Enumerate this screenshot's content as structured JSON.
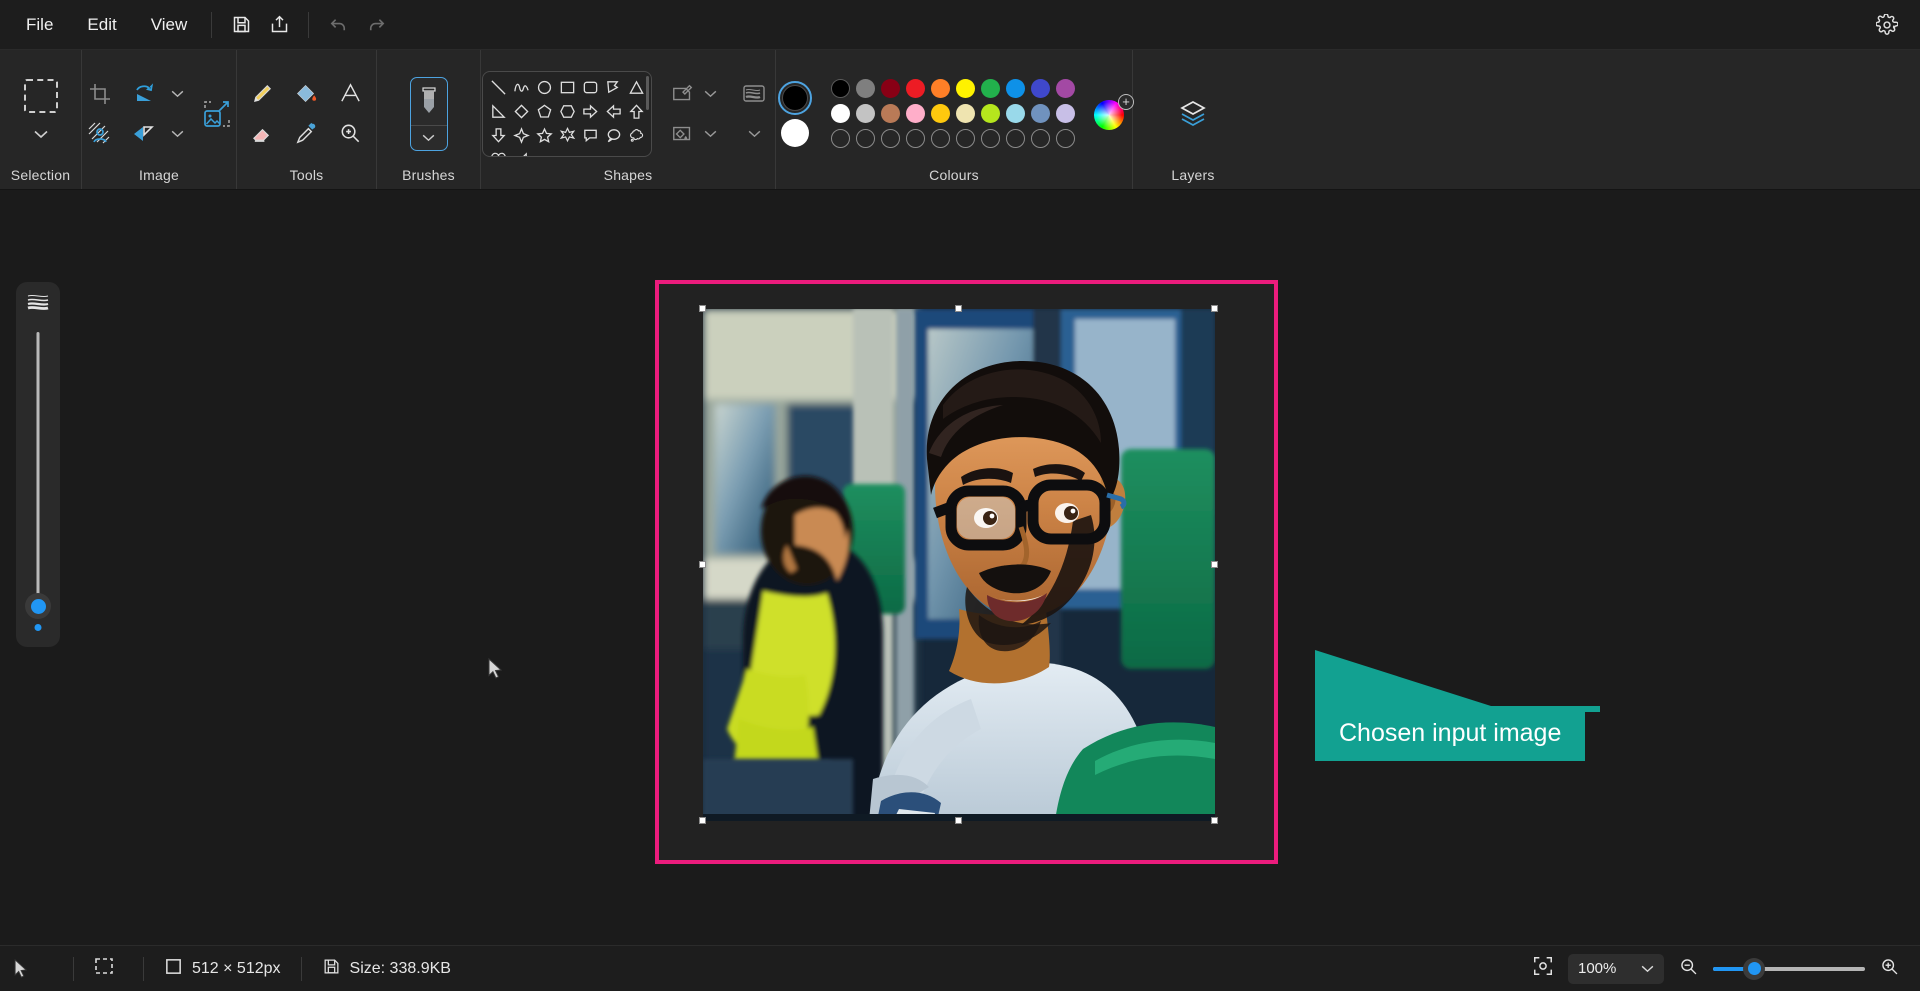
{
  "menubar": {
    "items": [
      {
        "label": "File",
        "name": "menu-file"
      },
      {
        "label": "Edit",
        "name": "menu-edit"
      },
      {
        "label": "View",
        "name": "menu-view"
      }
    ],
    "buttons": [
      {
        "icon": "save-icon",
        "name": "save-button"
      },
      {
        "icon": "share-icon",
        "name": "share-button"
      },
      {
        "icon": "undo-icon",
        "name": "undo-button"
      },
      {
        "icon": "redo-icon",
        "name": "redo-button"
      }
    ],
    "settings_icon": "gear-icon"
  },
  "ribbon": {
    "groups": [
      {
        "label": "Selection"
      },
      {
        "label": "Image"
      },
      {
        "label": "Tools"
      },
      {
        "label": "Brushes"
      },
      {
        "label": "Shapes"
      },
      {
        "label": "Colours"
      },
      {
        "label": "Layers"
      }
    ],
    "selection": {
      "rect_select_icon": "rectangle-select-icon",
      "dropdown_icon": "chevron-down-icon"
    },
    "image": {
      "crop_icon": "crop-icon",
      "rotate_icon": "rotate-icon",
      "rotate_dropdown_icon": "chevron-down-icon",
      "remove_background_icon": "remove-background-icon",
      "flip_icon": "flip-icon",
      "flip_dropdown_icon": "chevron-down-icon",
      "resize_icon": "resize-image-icon"
    },
    "tools": {
      "pencil_icon": "pencil-icon",
      "fill_icon": "paint-bucket-icon",
      "text_icon": "text-tool-icon",
      "eraser_icon": "eraser-icon",
      "eyedropper_icon": "eyedropper-icon",
      "magnifier_icon": "magnifier-icon"
    },
    "brushes": {
      "brush_icon": "brush-icon",
      "dropdown_icon": "chevron-down-icon"
    },
    "shapes": {
      "list": [
        "line-shape",
        "curve-shape",
        "ellipse-shape",
        "rectangle-shape",
        "rounded-rectangle-shape",
        "polygon-shape",
        "triangle-shape",
        "right-triangle-shape",
        "diamond-shape",
        "pentagon-shape",
        "hexagon-shape",
        "right-arrow-shape",
        "left-arrow-shape",
        "up-arrow-shape",
        "down-arrow-shape",
        "four-point-star-shape",
        "five-point-star-shape",
        "six-point-star-shape",
        "rounded-callout-shape",
        "oval-callout-shape",
        "cloud-callout-shape",
        "heart-shape",
        "lightning-shape"
      ],
      "outline_icon": "shape-outline-icon",
      "outline_dropdown_icon": "chevron-down-icon",
      "fill_icon": "shape-fill-icon",
      "fill_dropdown_icon": "chevron-down-icon",
      "thickness_icon": "line-thickness-icon",
      "thickness_dropdown_icon": "chevron-down-icon"
    },
    "colours": {
      "primary": "#000000",
      "secondary": "#ffffff",
      "row1": [
        "#000000",
        "#7f7f7f",
        "#880015",
        "#ed1c24",
        "#ff7f27",
        "#fff200",
        "#22b14c",
        "#0e91e8",
        "#3f48cc",
        "#a349a4"
      ],
      "row2": [
        "#ffffff",
        "#c3c3c3",
        "#b97a57",
        "#ffaec9",
        "#ffc90e",
        "#efe4b0",
        "#b5e61d",
        "#99d9ea",
        "#7092be",
        "#c8bfe7"
      ],
      "row3": [
        "",
        "",
        "",
        "",
        "",
        "",
        "",
        "",
        "",
        ""
      ],
      "edit_colours_icon": "colour-wheel-icon",
      "add_colour_icon": "plus-icon"
    },
    "layers": {
      "layers_icon": "layers-icon"
    }
  },
  "canvas": {
    "selection_border_colour": "#ec1c7d",
    "image_alt": "photo-of-man-with-glasses-on-train",
    "brush_size_slider": {
      "icon": "brush-size-icon",
      "name": "brush-size-slider"
    }
  },
  "annotation": {
    "text": "Chosen input image",
    "colour": "#12a191"
  },
  "statusbar": {
    "selection_icon": "selection-indicator-icon",
    "selection_value": "",
    "dimensions_icon": "canvas-size-icon",
    "dimensions": "512 × 512px",
    "filesize_icon": "file-size-icon",
    "filesize": "Size: 338.9KB",
    "fit_icon": "fit-to-screen-icon",
    "zoom_level": "100%",
    "zoom_dropdown_icon": "chevron-down-icon",
    "zoom_out_icon": "zoom-out-icon",
    "zoom_in_icon": "zoom-in-icon",
    "cursor_icon": "cursor-arrow-icon"
  }
}
